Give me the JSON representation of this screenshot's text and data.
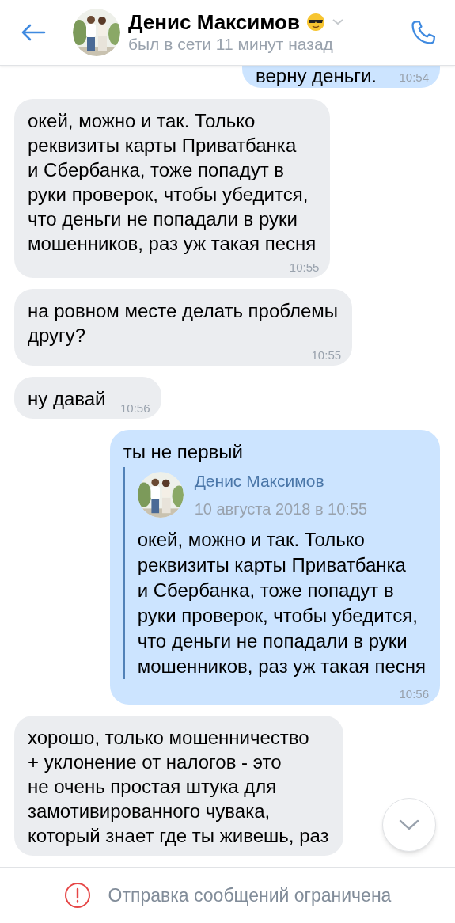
{
  "header": {
    "name": "Денис Максимов",
    "status": "был в сети 11 минут назад"
  },
  "messages": [
    {
      "kind": "outgoing",
      "text": "верну деньги.",
      "time": "10:54"
    },
    {
      "kind": "incoming",
      "text": "окей, можно и так. Только\nреквизиты карты Приватбанка\nи Сбербанка, тоже попадут в\nруки проверок, чтобы убедится,\nчто деньги не попадали в руки\nмошенников, раз уж такая песня",
      "time": "10:55"
    },
    {
      "kind": "incoming",
      "text": "на ровном месте делать проблемы\nдругу?",
      "time": "10:55"
    },
    {
      "kind": "incoming",
      "text": "ну давай",
      "time": "10:56"
    },
    {
      "kind": "outgoing",
      "text": "ты не первый",
      "time": "10:56",
      "forward": {
        "name": "Денис Максимов",
        "date": "10 августа 2018 в 10:55",
        "text": "окей, можно и так. Только\nреквизиты карты Приватбанка\nи Сбербанка, тоже попадут в\nруки проверок, чтобы убедится,\nчто деньги не попадали в руки\nмошенников, раз уж такая песня"
      }
    },
    {
      "kind": "incoming",
      "text": "хорошо, только мошенничество\n+ уклонение от налогов - это\nне очень простая штука для\nзамотивированного чувака,\nкоторый знает где ты живешь, раз"
    }
  ],
  "notice": "Отправка сообщений ограничена"
}
